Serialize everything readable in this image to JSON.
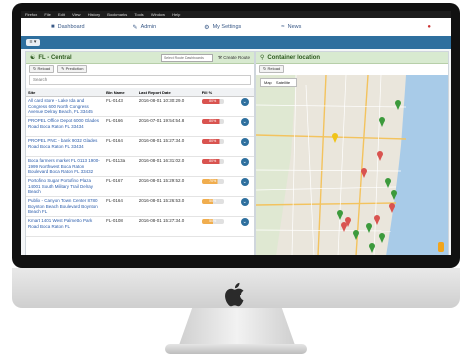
{
  "menubar": {
    "items": [
      "Firefox",
      "File",
      "Edit",
      "View",
      "History",
      "Bookmarks",
      "Tools",
      "Window",
      "Help"
    ]
  },
  "topnav": {
    "dashboard_label": "Dashboard",
    "admin_label": "Admin",
    "settings_label": "My Settings",
    "news_label": "News"
  },
  "blueband": {
    "chip_label": "≡ ▾"
  },
  "left_panel": {
    "title": "FL - Central",
    "route_select": "Select Route Dashboards",
    "route_button": "Create Route",
    "reload_label": "Reload",
    "prediction_label": "Prediction",
    "search_placeholder": "Search",
    "columns": [
      "Site",
      "Bin Name",
      "Last Report Date",
      "Fill %",
      ""
    ],
    "rows": [
      {
        "site": "All card store - Lake Ida and Congress 600 North Congress Avenue Delray Beach, FL 33445",
        "bin": "FL-0143",
        "date": "2016-08-01 10:30:29.0",
        "fill": 80,
        "fill_label": "80%",
        "color": "#d9534f"
      },
      {
        "site": "PROPEL Office Depot 6000 Glades Road Boca Raton FL 33434",
        "bin": "FL-0166",
        "date": "2016-07-01 19:54:54.8",
        "fill": 80,
        "fill_label": "80%",
        "color": "#d9534f"
      },
      {
        "site": "PROPEL PNC - bank 9032 Glades Road Boca Raton FL 33434",
        "bin": "FL-0164",
        "date": "2016-08-01 15:27:34.0",
        "fill": 80,
        "fill_label": "80%",
        "color": "#d9534f"
      },
      {
        "site": "Boca farmers market FL 0113 1900-1999 Northwest Boca Raton Boulevard Boca Raton FL 33432",
        "bin": "FL-0113a",
        "date": "2016-08-01 16:31:02.0",
        "fill": 80,
        "fill_label": "80%",
        "color": "#d9534f"
      },
      {
        "site": "Portofino Sugar Portofino Plaza 14001 South Military Trail Delray Beach",
        "bin": "FL-0167",
        "date": "2016-08-01 15:29:52.0",
        "fill": 70,
        "fill_label": "70%",
        "color": "#f0ad4e"
      },
      {
        "site": "Publix - Canyon Town Center 8780 Boynton Beach Boulevard Boynton Beach FL",
        "bin": "FL-0164",
        "date": "2016-08-01 15:26:53.0",
        "fill": 50,
        "fill_label": "50%",
        "color": "#f0ad4e"
      },
      {
        "site": "Kmart 1401 West Palmetto Park Road Boca Raton FL",
        "bin": "FL-0108",
        "date": "2016-08-01 15:27:34.0",
        "fill": 50,
        "fill_label": "50%",
        "color": "#f0ad4e"
      }
    ]
  },
  "right_panel": {
    "title": "Container location",
    "reload_label": "Reload",
    "map_tab": "Map",
    "satellite_tab": "Satellite"
  },
  "colors": {
    "nav_blue": "#2e6f9e",
    "panel_green": "#d8ead0",
    "pin_red": "#d9534f",
    "pin_green": "#3c9a3c",
    "pin_yellow": "#f0c419"
  }
}
